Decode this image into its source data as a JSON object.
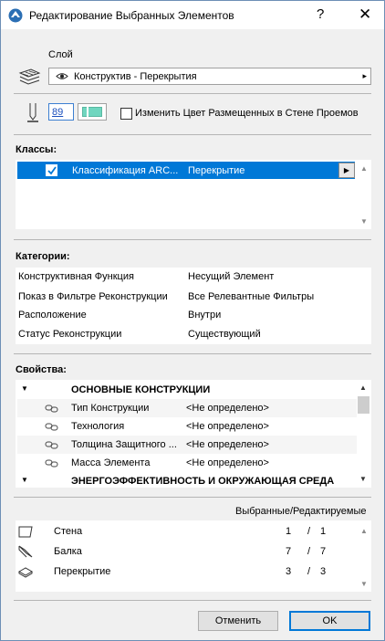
{
  "window": {
    "title": "Редактирование Выбранных Элементов",
    "help": "?",
    "close": "✕"
  },
  "layer": {
    "label": "Слой",
    "value": "Конструктив - Перекрытия",
    "arrow": "▸"
  },
  "pen": {
    "number": "89",
    "option_label": "Изменить Цвет Размещенных в Стене Проемов",
    "option_checked": false,
    "pen_color": "#6fd6bf"
  },
  "classes": {
    "header": "Классы:",
    "rows": [
      {
        "checked": true,
        "system": "Классификация ARC...",
        "class": "Перекрытие"
      }
    ]
  },
  "categories": {
    "header": "Категории:",
    "rows": [
      {
        "name": "Конструктивная Функция",
        "value": "Несущий Элемент"
      },
      {
        "name": "Показ в Фильтре Реконструкции",
        "value": "Все Релевантные Фильтры"
      },
      {
        "name": "Расположение",
        "value": "Внутри"
      },
      {
        "name": "Статус Реконструкции",
        "value": "Существующий"
      }
    ]
  },
  "properties": {
    "header": "Свойства:",
    "group1": "ОСНОВНЫЕ КОНСТРУКЦИИ",
    "rows": [
      {
        "name": "Тип Конструкции",
        "value": "<Не определено>"
      },
      {
        "name": "Технология",
        "value": "<Не определено>"
      },
      {
        "name": "Толщина Защитного ...",
        "value": "<Не определено>"
      },
      {
        "name": "Масса Элемента",
        "value": "<Не определено>"
      }
    ],
    "group2": "ЭНЕРГОЭФФЕКТИВНОСТЬ И ОКРУЖАЮЩАЯ СРЕДА"
  },
  "elements": {
    "header": "Выбранные/Редактируемые",
    "rows": [
      {
        "name": "Стена",
        "selected": "1",
        "sep": "/",
        "editable": "1",
        "icon": "wall-icon"
      },
      {
        "name": "Балка",
        "selected": "7",
        "sep": "/",
        "editable": "7",
        "icon": "beam-icon"
      },
      {
        "name": "Перекрытие",
        "selected": "3",
        "sep": "/",
        "editable": "3",
        "icon": "slab-icon"
      }
    ]
  },
  "buttons": {
    "cancel": "Отменить",
    "ok": "OK"
  }
}
